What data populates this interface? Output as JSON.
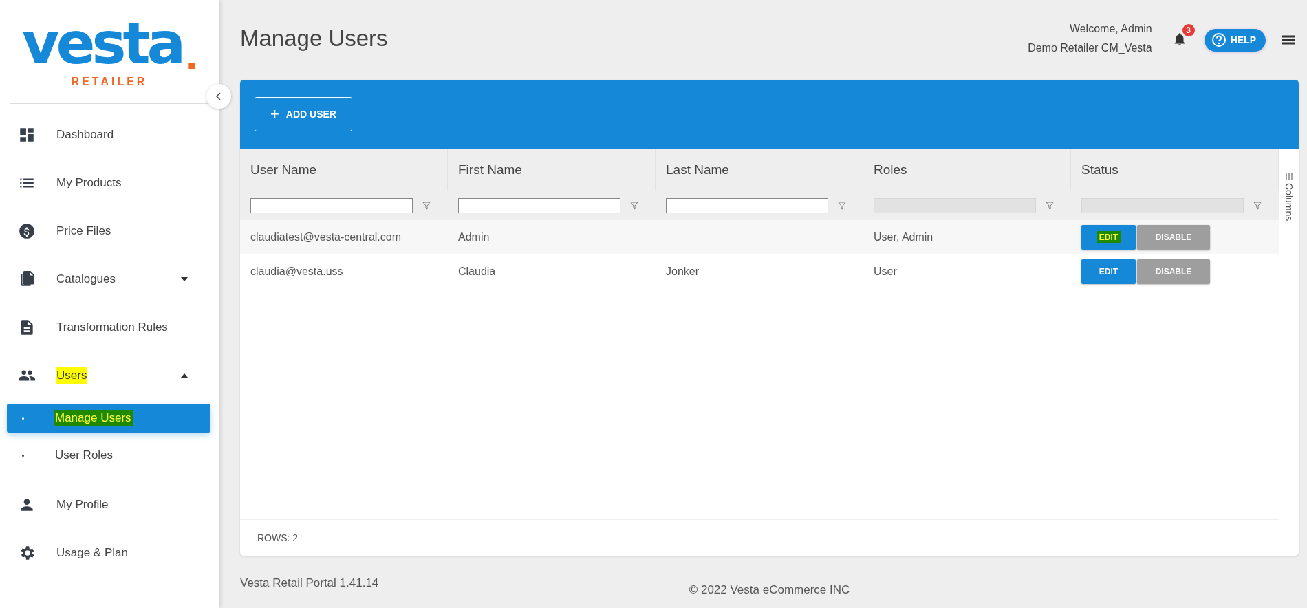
{
  "logo": {
    "wordmark": "vesta",
    "dot": ".",
    "tagline": "RETAILER"
  },
  "sidebar": {
    "items": [
      {
        "label": "Dashboard"
      },
      {
        "label": "My Products"
      },
      {
        "label": "Price Files"
      },
      {
        "label": "Catalogues",
        "expanded": false
      },
      {
        "label": "Transformation Rules"
      },
      {
        "label": "Users",
        "expanded": true,
        "highlight": {
          "color": "#ffff00"
        },
        "children": [
          {
            "label": "Manage Users",
            "selected": true,
            "highlight": {
              "color": "#1f8a00"
            }
          },
          {
            "label": "User Roles",
            "selected": false
          }
        ]
      },
      {
        "label": "My Profile"
      },
      {
        "label": "Usage & Plan"
      }
    ]
  },
  "page_title": "Manage Users",
  "header": {
    "welcome": "Welcome, Admin",
    "account": "Demo Retailer CM_Vesta",
    "notification_count": "3",
    "help_label": "HELP"
  },
  "toolbar": {
    "add_button": "ADD USER",
    "add_icon": "+"
  },
  "table": {
    "columns": [
      {
        "label": "User Name",
        "filter_disabled": false
      },
      {
        "label": "First Name",
        "filter_disabled": false
      },
      {
        "label": "Last Name",
        "filter_disabled": false
      },
      {
        "label": "Roles",
        "filter_disabled": true
      },
      {
        "label": "Status",
        "filter_disabled": true
      }
    ],
    "rows": [
      {
        "cells": [
          "claudiatest@vesta-central.com",
          "Admin",
          "",
          "User, Admin"
        ],
        "edit": "EDIT",
        "edit_highlight": {
          "color": "#1f8a00"
        },
        "disable": "DISABLE"
      },
      {
        "cells": [
          "claudia@vesta.uss",
          "Claudia",
          "Jonker",
          "User"
        ],
        "edit": "EDIT",
        "disable": "DISABLE"
      }
    ],
    "side_panel_label": "Columns",
    "rows_count": "ROWS: 2"
  },
  "footer": {
    "version": "Vesta Retail Portal 1.41.14",
    "copyright": "© 2022 Vesta eCommerce INC"
  }
}
